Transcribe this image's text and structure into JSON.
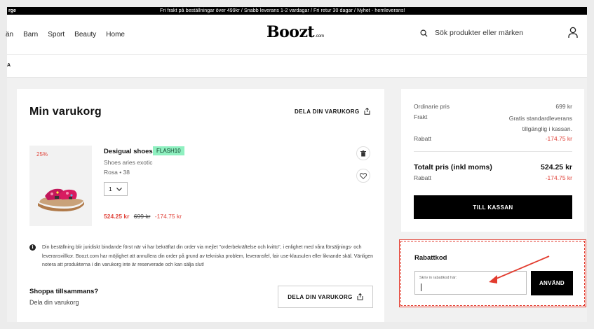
{
  "topbar": {
    "left_text": "rge",
    "announcement": "Fri frakt på beställningar över 499kr  /  Snabb leverans 1-2 vardagar  /  Fri retur 30 dagar / Nyhet - hemleverans!"
  },
  "header": {
    "nav": [
      "än",
      "Barn",
      "Sport",
      "Beauty",
      "Home"
    ],
    "logo": "Boozt",
    "logo_suffix": ".com",
    "search_placeholder": "Sök produkter eller märken",
    "search_icon": "search-icon",
    "user_icon": "user-icon"
  },
  "subbar": {
    "label": "A"
  },
  "cart": {
    "title": "Min varukorg",
    "share_label": "DELA DIN VARUKORG",
    "item": {
      "discount_badge": "25%",
      "brand": "Desigual shoes",
      "promo_tag": "FLASH10",
      "name": "Shoes aries exotic",
      "variant": "Rosa  •  38",
      "quantity": "1",
      "price_now": "524.25 kr",
      "price_old": "699 kr",
      "price_diff": "-174.75 kr"
    },
    "info_text": "Din beställning blir juridiskt bindande först när vi har bekräftat din order via mejlet \"orderbekräftelse och kvitto\", i enlighet med våra försäljnings- och leveransvillkor. Boozt.com har möjlighet att annullera din order på grund av tekniska problem, leveransfel, fair use-klausulen eller liknande skäl. Vänligen notera att produkterna i din varukorg inte är reserverade och kan sälja slut!",
    "shop_together_title": "Shoppa tillsammans?",
    "shop_together_sub": "Dela din varukorg",
    "share_button": "DELA DIN VARUKORG"
  },
  "summary": {
    "ordinary_label": "Ordinarie pris",
    "ordinary_value": "699 kr",
    "shipping_label": "Frakt",
    "shipping_value_1": "Gratis standardleverans",
    "shipping_value_2": "tillgänglig i kassan.",
    "discount_label": "Rabatt",
    "discount_value": "-174.75 kr",
    "total_label": "Totalt pris (inkl moms)",
    "total_value": "524.25 kr",
    "discount2_label": "Rabatt",
    "discount2_value": "-174.75 kr",
    "checkout_button": "TILL KASSAN"
  },
  "promo": {
    "title": "Rabattkod",
    "input_placeholder": "Skriv in rabattkod här:",
    "apply_button": "ANVÄND"
  },
  "colors": {
    "accent_red": "#e0453c",
    "promo_tag_bg": "#8ff0c0",
    "annotation_red": "#e23b2e"
  }
}
